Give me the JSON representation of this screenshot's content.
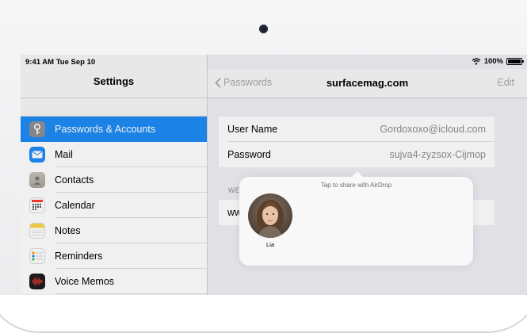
{
  "status": {
    "time": "9:41 AM  Tue Sep 10",
    "battery": "100%",
    "battery_level": 1.0
  },
  "sidebar": {
    "title": "Settings",
    "items": [
      {
        "label": "Passwords & Accounts",
        "icon": "key-icon",
        "color": "#8e8e93",
        "selected": true
      },
      {
        "label": "Mail",
        "icon": "mail-icon",
        "color": "#1f8bf5"
      },
      {
        "label": "Contacts",
        "icon": "contacts-icon",
        "color": "#a9a49c"
      },
      {
        "label": "Calendar",
        "icon": "calendar-icon",
        "color": "#ffffff"
      },
      {
        "label": "Notes",
        "icon": "notes-icon",
        "color": "#f9d54a"
      },
      {
        "label": "Reminders",
        "icon": "reminders-icon",
        "color": "#ffffff"
      },
      {
        "label": "Voice Memos",
        "icon": "voice-memos-icon",
        "color": "#1c1c1e"
      }
    ]
  },
  "detail": {
    "back_label": "Passwords",
    "title": "surfacemag.com",
    "edit_label": "Edit",
    "username_label": "User Name",
    "username_value": "Gordoxoxo@icloud.com",
    "password_label": "Password",
    "password_value": "sujva4-zyzsox-Cijmop",
    "website_section": "WE",
    "website_value": "ww"
  },
  "airdrop": {
    "hint": "Tap to share with AirDrop",
    "contact_name": "Lia"
  },
  "colors": {
    "accent": "#1f8bf5",
    "background": "#efeff4"
  }
}
